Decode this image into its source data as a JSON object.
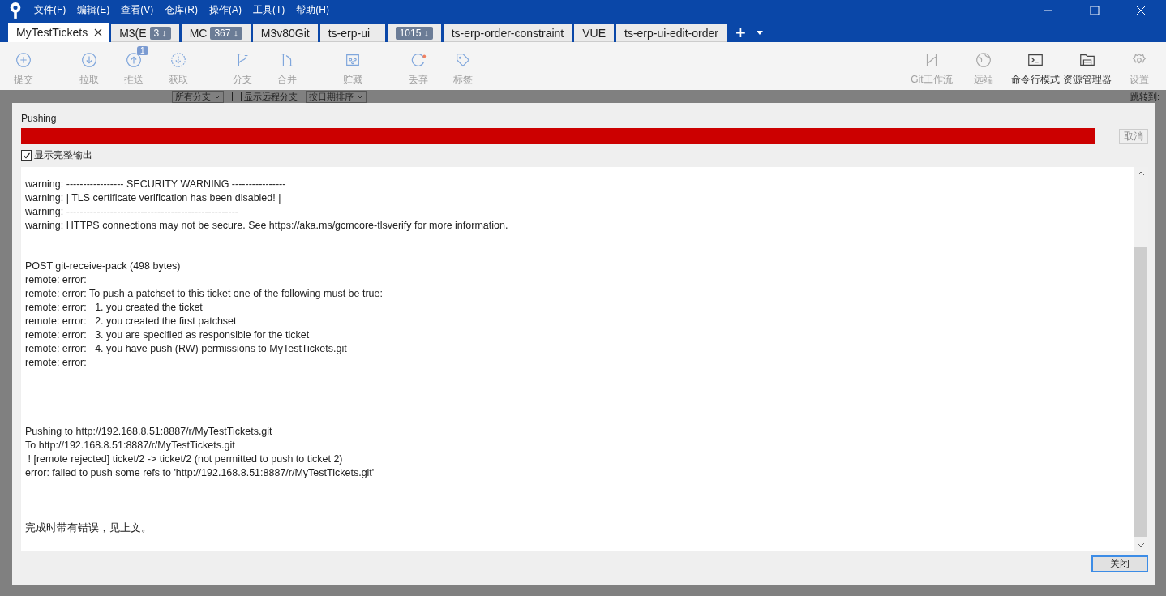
{
  "menu": [
    "文件(F)",
    "编辑(E)",
    "查看(V)",
    "仓库(R)",
    "操作(A)",
    "工具(T)",
    "帮助(H)"
  ],
  "tabs": [
    {
      "label": "MyTestTickets",
      "selected": true,
      "closable": true
    },
    {
      "label": "M3(E",
      "selected": false,
      "badge": "3 ↓"
    },
    {
      "label": "MC",
      "selected": false,
      "badge": "367 ↓"
    },
    {
      "label": "M3v80Git",
      "selected": false
    },
    {
      "label": "ts-erp-ui",
      "selected": false
    },
    {
      "selected": false,
      "badge": "1015 ↓"
    },
    {
      "label": "ts-erp-order-constraint",
      "selected": false
    },
    {
      "label": "VUE",
      "selected": false
    },
    {
      "label": "ts-erp-ui-edit-order",
      "selected": false
    }
  ],
  "new_tab": "+",
  "toolbar_left": [
    {
      "kind": "commit",
      "label": "提交",
      "disabled": true
    },
    {
      "kind": "pull",
      "label": "拉取",
      "disabled": true
    },
    {
      "kind": "push",
      "label": "推送",
      "disabled": true,
      "badge": "1"
    },
    {
      "kind": "fetch",
      "label": "获取",
      "disabled": true
    },
    {
      "kind": "branch",
      "label": "分支",
      "disabled": true
    },
    {
      "kind": "merge",
      "label": "合并",
      "disabled": true
    },
    {
      "kind": "stash",
      "label": "贮藏",
      "disabled": true
    },
    {
      "kind": "discard",
      "label": "丢弃",
      "disabled": true
    },
    {
      "kind": "tag",
      "label": "标签",
      "disabled": true
    }
  ],
  "toolbar_right": [
    {
      "kind": "flow",
      "label": "Git工作流",
      "disabled": true
    },
    {
      "kind": "remote",
      "label": "远端",
      "disabled": true
    },
    {
      "kind": "terminal",
      "label": "命令行模式",
      "disabled": false
    },
    {
      "kind": "explorer",
      "label": "资源管理器",
      "disabled": false
    },
    {
      "kind": "settings",
      "label": "设置",
      "disabled": true
    }
  ],
  "filter_bar": {
    "branches": "所有分支",
    "show_remote": {
      "label": "显示远程分支",
      "checked": false
    },
    "sort": "按日期排序",
    "jump": "跳转到:"
  },
  "dialog": {
    "title": "Pushing",
    "progress": {
      "level": 1,
      "failed": true
    },
    "cancel": {
      "label": "取消",
      "disabled": true
    },
    "full_output": {
      "label": "显示完整输出",
      "checked": true
    },
    "output": [
      [
        "warning: ----------------- SECURITY WARNING ----------------",
        "warning: | TLS certificate verification has been disabled! |",
        "warning: ---------------------------------------------------",
        "warning: HTTPS connections may not be secure. See https://aka.ms/gcmcore-tlsverify for more information."
      ],
      [
        "POST git-receive-pack (498 bytes)",
        "remote: error:",
        "remote: error: To push a patchset to this ticket one of the following must be true:",
        "remote: error:   1. you created the ticket",
        "remote: error:   2. you created the first patchset",
        "remote: error:   3. you are specified as responsible for the ticket",
        "remote: error:   4. you have push (RW) permissions to MyTestTickets.git",
        "remote: error:"
      ],
      [
        "Pushing to http://192.168.8.51:8887/r/MyTestTickets.git",
        "To http://192.168.8.51:8887/r/MyTestTickets.git",
        " ! [remote rejected] ticket/2 -> ticket/2 (not permitted to push to ticket 2)",
        "error: failed to push some refs to 'http://192.168.8.51:8887/r/MyTestTickets.git'"
      ],
      [
        "完成时带有错误，见上文。"
      ]
    ],
    "close": "关闭"
  }
}
